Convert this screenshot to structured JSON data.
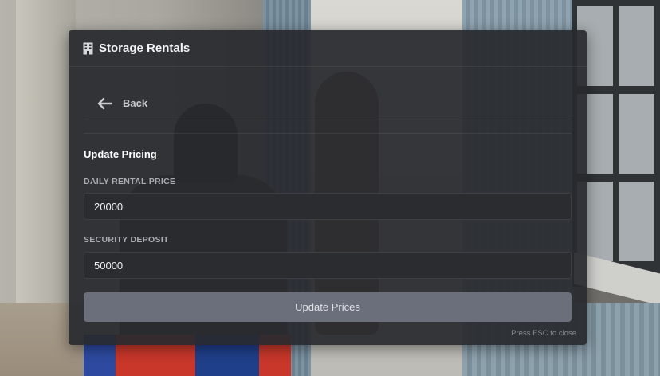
{
  "window": {
    "title": "Storage Rentals",
    "title_icon": "building-icon"
  },
  "nav": {
    "back_label": "Back",
    "back_icon": "arrow-left-icon"
  },
  "form": {
    "section_title": "Update Pricing",
    "daily_price": {
      "label": "DAILY RENTAL PRICE",
      "value": "20000"
    },
    "security_deposit": {
      "label": "SECURITY DEPOSIT",
      "value": "50000"
    },
    "submit_label": "Update Prices"
  },
  "footer": {
    "hint": "Press ESC to close"
  },
  "colors": {
    "panel_bg": "#282a2e",
    "input_bg": "#2a2c30",
    "button_bg": "#6b6f7b",
    "label_text": "#a9acb2"
  }
}
